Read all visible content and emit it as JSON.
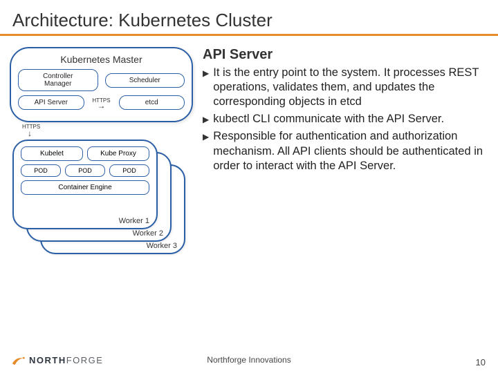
{
  "title": "Architecture: Kubernetes Cluster",
  "diagram": {
    "master_title": "Kubernetes Master",
    "controller_manager": "Controller\nManager",
    "scheduler": "Scheduler",
    "api_server": "API Server",
    "etcd": "etcd",
    "https_label_h": "HTTPS",
    "https_label_v": "HTTPS",
    "worker": {
      "kubelet": "Kubelet",
      "kube_proxy": "Kube Proxy",
      "pod": "POD",
      "container_engine": "Container Engine",
      "labels": [
        "Worker 1",
        "Worker 2",
        "Worker 3"
      ]
    }
  },
  "detail": {
    "heading": "API Server",
    "bullets": [
      "It is the entry point to the system. It processes REST operations, validates them, and updates the corresponding objects in etcd",
      "kubectl CLI communicate with the API Server.",
      "Responsible for authentication and authorization mechanism. All API clients should be authenticated in order to interact with the API Server."
    ]
  },
  "footer": {
    "brand_left": "NORTH",
    "brand_right": "FORGE",
    "center": "Northforge Innovations",
    "page": "10"
  }
}
